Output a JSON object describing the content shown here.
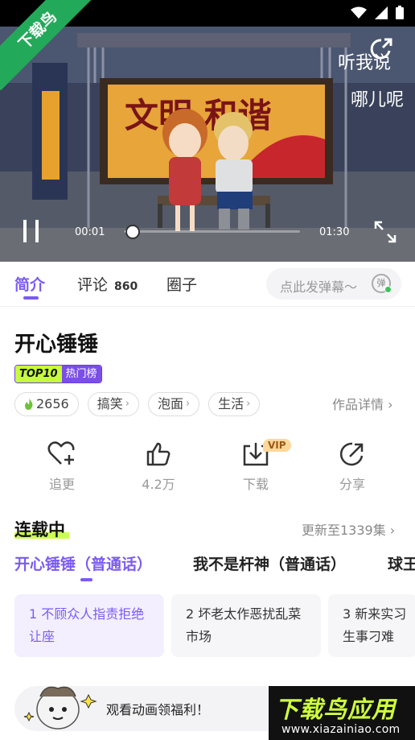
{
  "watermark": {
    "corner": "下载鸟",
    "logo_big": "下载鸟应用",
    "logo_url": "www.xiazainiao.com"
  },
  "video": {
    "sign_text": "文明 和谐",
    "overlay_text_1": "听我说",
    "overlay_text_2": "哪儿呢",
    "current_time": "00:01",
    "duration": "01:30",
    "progress": 0.02
  },
  "tabs": [
    {
      "label": "简介",
      "active": true
    },
    {
      "label": "评论",
      "count": "860"
    },
    {
      "label": "圈子"
    }
  ],
  "danmu": {
    "placeholder": "点此发弹幕～",
    "badge": "弹"
  },
  "show": {
    "title": "开心锤锤",
    "rank_top": "TOP10",
    "rank_label": "热门榜",
    "heat": "2656",
    "tags": [
      "搞笑",
      "泡面",
      "生活"
    ],
    "details_link": "作品详情 ›"
  },
  "actions": [
    {
      "icon": "heart-plus-icon",
      "label": "追更"
    },
    {
      "icon": "thumbs-up-icon",
      "label": "4.2万"
    },
    {
      "icon": "download-icon",
      "label": "下载",
      "badge": "VIP"
    },
    {
      "icon": "share-icon",
      "label": "分享"
    }
  ],
  "series": {
    "heading": "连载中",
    "update": "更新至1339集 ›",
    "versions": [
      {
        "label": "开心锤锤（普通话）",
        "active": true
      },
      {
        "label": "我不是杆神（普通话）"
      },
      {
        "label": "球王"
      }
    ],
    "episodes": [
      {
        "title": "1 不顾众人指责拒绝让座",
        "active": true
      },
      {
        "title": "2 坏老太作恶扰乱菜市场"
      },
      {
        "title": "3 新来实习生事刁难"
      }
    ]
  },
  "banner": {
    "text": "观看动画领福利！"
  },
  "colors": {
    "accent": "#7b5bf0",
    "lime": "#c6ff3a"
  }
}
